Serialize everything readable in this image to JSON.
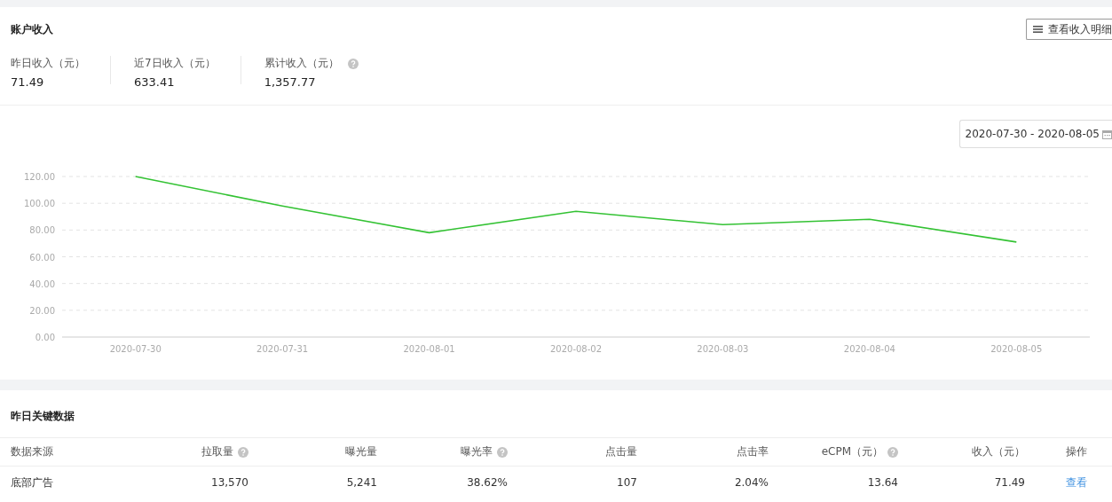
{
  "account": {
    "title": "账户收入",
    "detail_button": "查看收入明细",
    "metrics": [
      {
        "label": "昨日收入（元）",
        "value": "71.49",
        "help": false
      },
      {
        "label": "近7日收入（元）",
        "value": "633.41",
        "help": false
      },
      {
        "label": "累计收入（元）",
        "value": "1,357.77",
        "help": true
      }
    ]
  },
  "date_range": "2020-07-30 - 2020-08-05",
  "chart_data": {
    "type": "line",
    "categories": [
      "2020-07-30",
      "2020-07-31",
      "2020-08-01",
      "2020-08-02",
      "2020-08-03",
      "2020-08-04",
      "2020-08-05"
    ],
    "series": [
      {
        "color": "#33c233",
        "values": [
          120,
          98,
          78,
          94,
          84,
          88,
          71
        ]
      }
    ],
    "grid": true,
    "ylim": [
      0,
      120
    ],
    "yticks": [
      {
        "value": 0,
        "label": "0.00"
      },
      {
        "value": 20,
        "label": "20.00"
      },
      {
        "value": 40,
        "label": "40.00"
      },
      {
        "value": 60,
        "label": "60.00"
      },
      {
        "value": 80,
        "label": "80.00"
      },
      {
        "value": 100,
        "label": "100.00"
      },
      {
        "value": 120,
        "label": "120.00"
      }
    ]
  },
  "key_data": {
    "title": "昨日关键数据",
    "columns": [
      {
        "label": "数据来源",
        "help": false
      },
      {
        "label": "拉取量",
        "help": true
      },
      {
        "label": "曝光量",
        "help": false
      },
      {
        "label": "曝光率",
        "help": true
      },
      {
        "label": "点击量",
        "help": false
      },
      {
        "label": "点击率",
        "help": false
      },
      {
        "label": "eCPM（元）",
        "help": true
      },
      {
        "label": "收入（元）",
        "help": false
      },
      {
        "label": "操作",
        "help": false
      }
    ],
    "rows": [
      {
        "cells": [
          "底部广告",
          "13,570",
          "5,241",
          "38.62%",
          "107",
          "2.04%",
          "13.64",
          "71.49"
        ],
        "action": "查看"
      }
    ]
  }
}
